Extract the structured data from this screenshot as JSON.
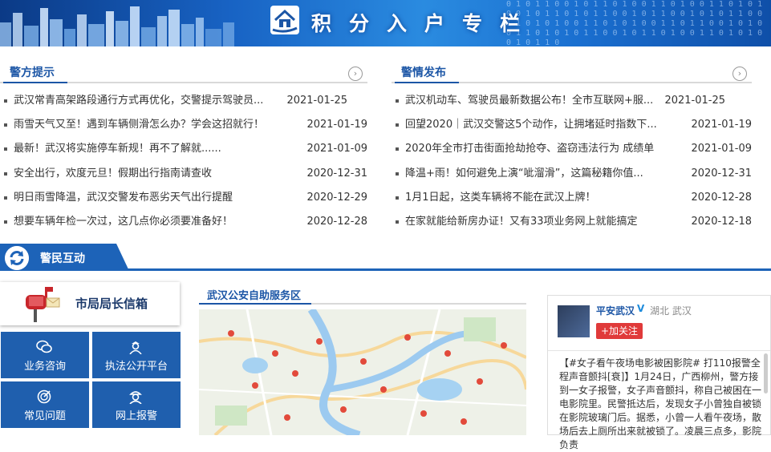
{
  "banner": {
    "title": "积分入户专栏",
    "logo_icon": "house-hand-icon"
  },
  "police_tips": {
    "heading": "警方提示",
    "more_icon": "chevron-right-icon",
    "items": [
      {
        "title": "武汉常青高架路段通行方式再优化，交警提示驾驶员...",
        "date": "2021-01-25"
      },
      {
        "title": "雨雪天气又至！遇到车辆侧滑怎么办？学会这招就行！",
        "date": "2021-01-19"
      },
      {
        "title": "最新！武汉将实施停车新规！再不了解就......",
        "date": "2021-01-09"
      },
      {
        "title": "安全出行，欢度元旦！假期出行指南请查收",
        "date": "2020-12-31"
      },
      {
        "title": "明日雨雪降温，武汉交警发布恶劣天气出行提醒",
        "date": "2020-12-29"
      },
      {
        "title": "想要车辆年检一次过，这几点你必须要准备好！",
        "date": "2020-12-28"
      }
    ]
  },
  "police_news": {
    "heading": "警情发布",
    "more_icon": "chevron-right-icon",
    "items": [
      {
        "title": "武汉机动车、驾驶员最新数据公布！全市互联网+服...",
        "date": "2021-01-25"
      },
      {
        "title": "回望2020｜武汉交警这5个动作，让拥堵延时指数下...",
        "date": "2021-01-19"
      },
      {
        "title": "2020年全市打击街面抢劫抢夺、盗窃违法行为 成绩单",
        "date": "2021-01-09"
      },
      {
        "title": "降温+雨！如何避免上演“呲溜滑”，这篇秘籍你值...",
        "date": "2020-12-31"
      },
      {
        "title": "1月1日起，这类车辆将不能在武汉上牌！",
        "date": "2020-12-28"
      },
      {
        "title": "在家就能给新房办证！又有33项业务网上就能搞定",
        "date": "2020-12-18"
      }
    ]
  },
  "interaction": {
    "heading": "警民互动",
    "mailbox_label": "市局局长信箱",
    "tiles": [
      {
        "label": "业务咨询",
        "icon": "chat-bubble-icon"
      },
      {
        "label": "执法公开平台",
        "icon": "police-officer-icon"
      },
      {
        "label": "常见问题",
        "icon": "target-question-icon"
      },
      {
        "label": "网上报警",
        "icon": "alarm-officer-icon"
      }
    ]
  },
  "service_map": {
    "heading": "武汉公安自助服务区"
  },
  "weibo": {
    "name": "平安武汉",
    "verified": "V",
    "location": "湖北 武汉",
    "follow_label": "+加关注",
    "post": "【#女子看午夜场电影被困影院# 打110报警全程声音颤抖[衰]】1月24日，广西柳州，警方接到一女子报警，女子声音颤抖，称自己被困在一电影院里。民警抵达后，发现女子小曾独自被锁在影院玻璃门后。据悉，小曾一人看午夜场，散场后去上厕所出来就被锁了。凌晨三点多，影院负责"
  },
  "colors": {
    "brand_blue": "#1d63b8",
    "tile_blue": "#1f5fae",
    "follow_red": "#e03a3a"
  }
}
